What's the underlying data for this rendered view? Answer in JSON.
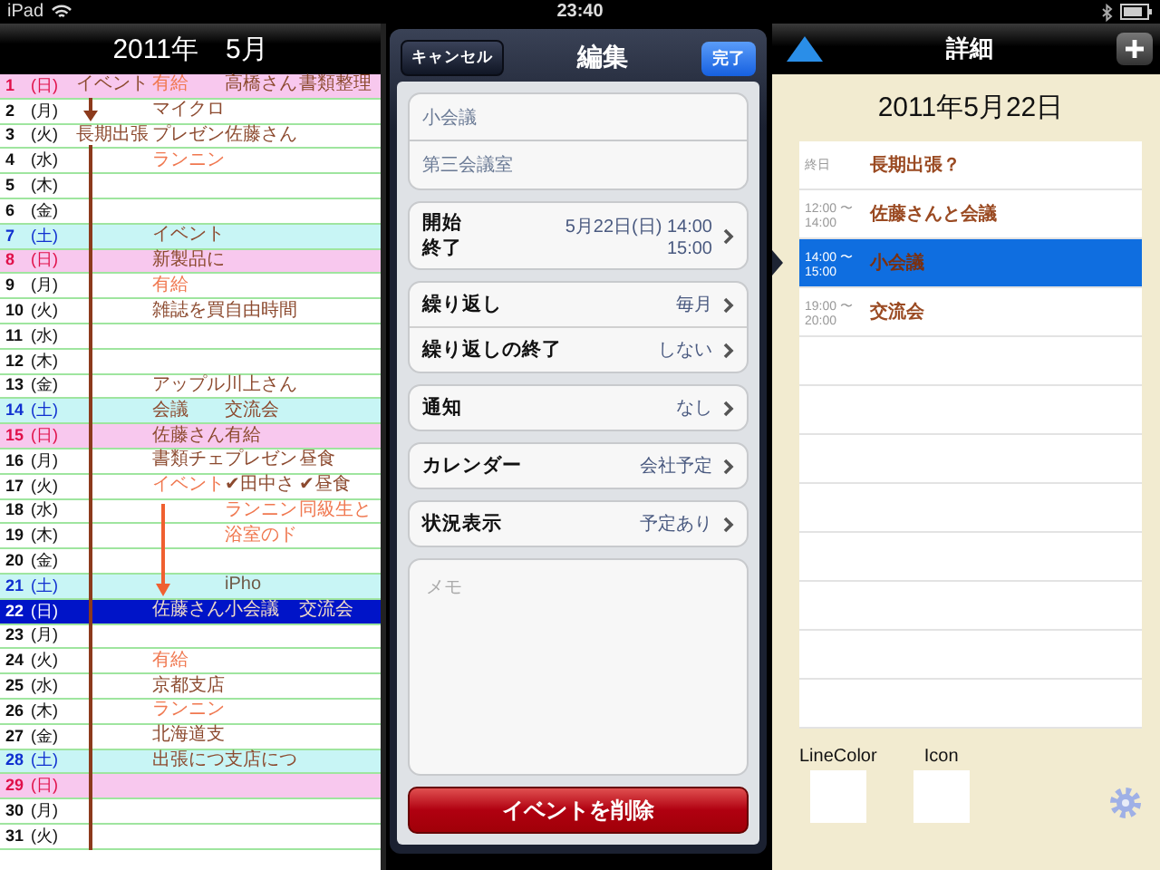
{
  "status_bar": {
    "device": "iPad",
    "time": "23:40"
  },
  "calendar": {
    "title": "2011年　5月",
    "rows": [
      {
        "day": "1",
        "weekday": "(日)",
        "kind": "sunday",
        "selected": false,
        "cells": {
          "column_1": {
            "text": "イベント",
            "color": "#8c4a2f"
          },
          "column_2": {
            "text": "有給",
            "color": "#f07850"
          },
          "column_3": {
            "text": "高橋さん",
            "color": "#8c4a2f"
          },
          "column_4": {
            "text": "書類整理",
            "color": "#8c4a2f"
          }
        }
      },
      {
        "day": "2",
        "weekday": "(月)",
        "kind": "weekday",
        "selected": false,
        "cells": {
          "column_2": {
            "text": "マイクロ",
            "color": "#8c4a2f"
          }
        }
      },
      {
        "day": "3",
        "weekday": "(火)",
        "kind": "weekday",
        "selected": false,
        "cells": {
          "column_1": {
            "text": "長期出張",
            "color": "#8c4a2f"
          },
          "column_2": {
            "text": "プレゼン",
            "color": "#8c4a2f"
          },
          "column_3": {
            "text": "佐藤さん",
            "color": "#8c4a2f"
          }
        }
      },
      {
        "day": "4",
        "weekday": "(水)",
        "kind": "weekday",
        "selected": false,
        "cells": {
          "column_2": {
            "text": "ランニン",
            "color": "#f07850"
          }
        }
      },
      {
        "day": "5",
        "weekday": "(木)",
        "kind": "weekday",
        "selected": false,
        "cells": {}
      },
      {
        "day": "6",
        "weekday": "(金)",
        "kind": "weekday",
        "selected": false,
        "cells": {}
      },
      {
        "day": "7",
        "weekday": "(土)",
        "kind": "saturday",
        "selected": false,
        "cells": {
          "column_2": {
            "text": "イベント",
            "color": "#8c4a2f"
          }
        }
      },
      {
        "day": "8",
        "weekday": "(日)",
        "kind": "sunday",
        "selected": false,
        "cells": {
          "column_2": {
            "text": "新製品に",
            "color": "#8c4a2f"
          }
        }
      },
      {
        "day": "9",
        "weekday": "(月)",
        "kind": "weekday",
        "selected": false,
        "cells": {
          "column_2": {
            "text": "有給",
            "color": "#f07850"
          }
        }
      },
      {
        "day": "10",
        "weekday": "(火)",
        "kind": "weekday",
        "selected": false,
        "cells": {
          "column_2": {
            "text": "雑誌を買",
            "color": "#8c4a2f"
          },
          "column_3": {
            "text": "自由時間",
            "color": "#8c4a2f"
          }
        }
      },
      {
        "day": "11",
        "weekday": "(水)",
        "kind": "weekday",
        "selected": false,
        "cells": {}
      },
      {
        "day": "12",
        "weekday": "(木)",
        "kind": "weekday",
        "selected": false,
        "cells": {}
      },
      {
        "day": "13",
        "weekday": "(金)",
        "kind": "weekday",
        "selected": false,
        "cells": {
          "column_2": {
            "text": "アップル",
            "color": "#8c4a2f"
          },
          "column_3": {
            "text": "川上さん",
            "color": "#8c4a2f"
          }
        }
      },
      {
        "day": "14",
        "weekday": "(土)",
        "kind": "saturday",
        "selected": false,
        "cells": {
          "column_2": {
            "text": "会議",
            "color": "#8c4a2f"
          },
          "column_3": {
            "text": "交流会",
            "color": "#8c4a2f"
          }
        }
      },
      {
        "day": "15",
        "weekday": "(日)",
        "kind": "sunday",
        "selected": false,
        "cells": {
          "column_2": {
            "text": "佐藤さん",
            "color": "#8c4a2f"
          },
          "column_3": {
            "text": "有給",
            "color": "#8c4a2f"
          }
        }
      },
      {
        "day": "16",
        "weekday": "(月)",
        "kind": "weekday",
        "selected": false,
        "cells": {
          "column_2": {
            "text": "書類チェ",
            "color": "#8c4a2f"
          },
          "column_3": {
            "text": "プレゼン",
            "color": "#8c4a2f"
          },
          "column_4": {
            "text": "昼食",
            "color": "#8c4a2f"
          }
        }
      },
      {
        "day": "17",
        "weekday": "(火)",
        "kind": "weekday",
        "selected": false,
        "cells": {
          "column_2": {
            "text": "イベント",
            "color": "#f07850"
          },
          "column_3": {
            "text": "✔田中さ",
            "color": "#8c4a2f"
          },
          "column_4": {
            "text": "✔昼食",
            "color": "#8c4a2f"
          }
        }
      },
      {
        "day": "18",
        "weekday": "(水)",
        "kind": "weekday",
        "selected": false,
        "cells": {
          "column_3": {
            "text": "ランニン",
            "color": "#f07850"
          },
          "column_4": {
            "text": "同級生と",
            "color": "#f07850"
          }
        }
      },
      {
        "day": "19",
        "weekday": "(木)",
        "kind": "weekday",
        "selected": false,
        "cells": {
          "column_3": {
            "text": "浴室のド",
            "color": "#f07850"
          }
        }
      },
      {
        "day": "20",
        "weekday": "(金)",
        "kind": "weekday",
        "selected": false,
        "cells": {}
      },
      {
        "day": "21",
        "weekday": "(土)",
        "kind": "saturday",
        "selected": false,
        "cells": {
          "column_3": {
            "text": "iPho",
            "color": "#6e5a48"
          }
        }
      },
      {
        "day": "22",
        "weekday": "(日)",
        "kind": "sunday",
        "selected": true,
        "cells": {
          "column_2": {
            "text": "佐藤さん",
            "color": "#f0dcc8"
          },
          "column_3": {
            "text": "小会議",
            "color": "#f0dcc8"
          },
          "column_4": {
            "text": "交流会",
            "color": "#f0dcc8"
          }
        }
      },
      {
        "day": "23",
        "weekday": "(月)",
        "kind": "weekday",
        "selected": false,
        "cells": {}
      },
      {
        "day": "24",
        "weekday": "(火)",
        "kind": "weekday",
        "selected": false,
        "cells": {
          "column_2": {
            "text": "有給",
            "color": "#f07850"
          }
        }
      },
      {
        "day": "25",
        "weekday": "(水)",
        "kind": "weekday",
        "selected": false,
        "cells": {
          "column_2": {
            "text": "京都支店",
            "color": "#8c4a2f"
          }
        }
      },
      {
        "day": "26",
        "weekday": "(木)",
        "kind": "weekday",
        "selected": false,
        "cells": {
          "column_2": {
            "text": "ランニン",
            "color": "#f07850"
          }
        }
      },
      {
        "day": "27",
        "weekday": "(金)",
        "kind": "weekday",
        "selected": false,
        "cells": {
          "column_2": {
            "text": "北海道支",
            "color": "#8c4a2f"
          }
        }
      },
      {
        "day": "28",
        "weekday": "(土)",
        "kind": "saturday",
        "selected": false,
        "cells": {
          "column_2": {
            "text": "出張につ",
            "color": "#8c4a2f"
          },
          "column_3": {
            "text": "支店につ",
            "color": "#8c4a2f"
          }
        }
      },
      {
        "day": "29",
        "weekday": "(日)",
        "kind": "sunday",
        "selected": false,
        "cells": {}
      },
      {
        "day": "30",
        "weekday": "(月)",
        "kind": "weekday",
        "selected": false,
        "cells": {}
      },
      {
        "day": "31",
        "weekday": "(火)",
        "kind": "weekday",
        "selected": false,
        "cells": {}
      }
    ]
  },
  "editor": {
    "cancel_button": "キャンセル",
    "title": "編集",
    "done_button": "完了",
    "title_field": {
      "value": "小会議"
    },
    "location_field": {
      "value": "第三会議室"
    },
    "time_row": {
      "start_label": "開始",
      "end_label": "終了",
      "start_value": "5月22日(日) 14:00",
      "end_value": "15:00"
    },
    "groups": [
      {
        "rows": [
          {
            "label": "繰り返し",
            "value": "毎月"
          },
          {
            "label": "繰り返しの終了",
            "value": "しない"
          }
        ]
      },
      {
        "rows": [
          {
            "label": "通知",
            "value": "なし"
          }
        ]
      },
      {
        "rows": [
          {
            "label": "カレンダー",
            "value": "会社予定"
          }
        ]
      },
      {
        "rows": [
          {
            "label": "状況表示",
            "value": "予定あり"
          }
        ]
      }
    ],
    "memo": {
      "placeholder": "メモ"
    },
    "delete_button": "イベントを削除"
  },
  "detail": {
    "title": "詳細",
    "date": "2011年5月22日",
    "events": [
      {
        "time_lines": [
          "終日"
        ],
        "title": "長期出張？",
        "selected": false
      },
      {
        "time_lines": [
          "12:00 〜",
          "14:00"
        ],
        "title": "佐藤さんと会議",
        "selected": false
      },
      {
        "time_lines": [
          "14:00 〜",
          "15:00"
        ],
        "title": "小会議",
        "selected": true
      },
      {
        "time_lines": [
          "19:00 〜",
          "20:00"
        ],
        "title": "交流会",
        "selected": false
      }
    ],
    "line_color_label": "LineColor",
    "icon_label": "Icon"
  }
}
